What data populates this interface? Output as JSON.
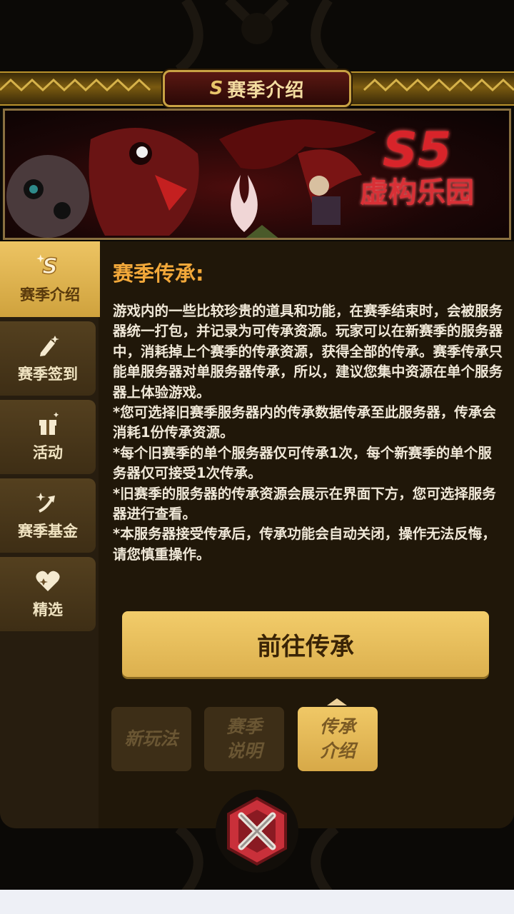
{
  "header": {
    "title": "赛季介绍",
    "title_icon": "season-s-icon"
  },
  "banner": {
    "season_code": "S5",
    "season_name": "虚构乐园"
  },
  "sidebar": {
    "items": [
      {
        "label": "赛季介绍",
        "icon": "season-s-icon",
        "active": true
      },
      {
        "label": "赛季签到",
        "icon": "pencil-sparkle-icon",
        "active": false
      },
      {
        "label": "活动",
        "icon": "gift-box-icon",
        "active": false
      },
      {
        "label": "赛季基金",
        "icon": "arrow-sparkle-icon",
        "active": false
      },
      {
        "label": "精选",
        "icon": "heart-icon",
        "active": false
      }
    ]
  },
  "content": {
    "heading": "赛季传承:",
    "paragraphs": [
      "游戏内的一些比较珍贵的道具和功能，在赛季结束时，会被服务器统一打包，并记录为可传承资源。玩家可以在新赛季的服务器中，消耗掉上个赛季的传承资源，获得全部的传承。赛季传承只能单服务器对单服务器传承，所以，建议您集中资源在单个服务器上体验游戏。",
      "*您可选择旧赛季服务器内的传承数据传承至此服务器，传承会消耗1份传承资源。",
      "*每个旧赛季的单个服务器仅可传承1次，每个新赛季的单个服务器仅可接受1次传承。",
      "*旧赛季的服务器的传承资源会展示在界面下方，您可选择服务器进行查看。",
      "*本服务器接受传承后，传承功能会自动关闭，操作无法反悔，请您慎重操作。"
    ],
    "action_button": "前往传承"
  },
  "sub_tabs": [
    {
      "label": "新玩法",
      "active": false
    },
    {
      "label": "赛季说明",
      "active": false
    },
    {
      "label": "传承介绍",
      "active": true
    }
  ],
  "close_icon": "close-x-icon",
  "colors": {
    "accent_gold": "#e3b955",
    "heading_orange": "#f2a83a",
    "season_red": "#d8242a"
  }
}
